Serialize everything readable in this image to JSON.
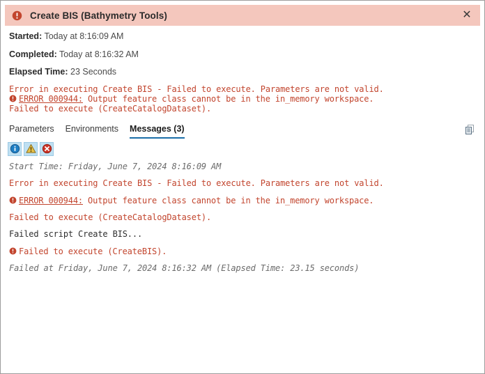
{
  "header": {
    "icon": "error-circle-icon",
    "title": "Create BIS (Bathymetry Tools)",
    "close_label": "✕",
    "background_color": "#f4c7bd",
    "icon_color": "#c2452e"
  },
  "summary": [
    {
      "label": "Started:",
      "value": "Today at 8:16:09 AM"
    },
    {
      "label": "Completed:",
      "value": "Today at 8:16:32 AM"
    },
    {
      "label": "Elapsed Time:",
      "value": "23 Seconds"
    }
  ],
  "top_error": {
    "line1": "Error in executing Create BIS - Failed to execute. Parameters are not valid.",
    "line2_link": "ERROR 000944:",
    "line2_rest": " Output feature class cannot be in the in_memory workspace.",
    "line3": "Failed to execute (CreateCatalogDataset)."
  },
  "tabs": [
    {
      "label": "Parameters",
      "active": false
    },
    {
      "label": "Environments",
      "active": false
    },
    {
      "label": "Messages (3)",
      "active": true
    }
  ],
  "copy_button": {
    "icon": "copy-icon",
    "title": "Copy"
  },
  "filters": [
    {
      "name": "info",
      "icon": "info-icon",
      "selected": true,
      "color": "#1f7fc4"
    },
    {
      "name": "warning",
      "icon": "warning-icon",
      "selected": true,
      "color": "#e8b31f"
    },
    {
      "name": "error",
      "icon": "error-x-icon",
      "selected": true,
      "color": "#cc3326"
    }
  ],
  "messages": [
    {
      "style": "muted-italic",
      "icon": null,
      "text": "Start Time: Friday, June 7, 2024 8:16:09 AM"
    },
    {
      "style": "err",
      "icon": null,
      "text": "Error in executing Create BIS - Failed to execute. Parameters are not valid."
    },
    {
      "style": "err",
      "icon": "error-circle-icon",
      "link": "ERROR 000944:",
      "text": " Output feature class cannot be in the in_memory workspace."
    },
    {
      "style": "err",
      "icon": null,
      "text": "Failed to execute (CreateCatalogDataset)."
    },
    {
      "style": "dark",
      "icon": null,
      "text": "Failed script Create BIS..."
    },
    {
      "style": "err",
      "icon": "error-circle-icon",
      "text": "Failed to execute (CreateBIS)."
    },
    {
      "style": "muted-italic",
      "icon": null,
      "text": "Failed at Friday, June 7, 2024 8:16:32 AM (Elapsed Time: 23.15 seconds)"
    }
  ],
  "colors": {
    "error_text": "#c2452e",
    "tab_accent": "#1a6ea8",
    "filter_selected_bg": "#bfe0f2"
  }
}
